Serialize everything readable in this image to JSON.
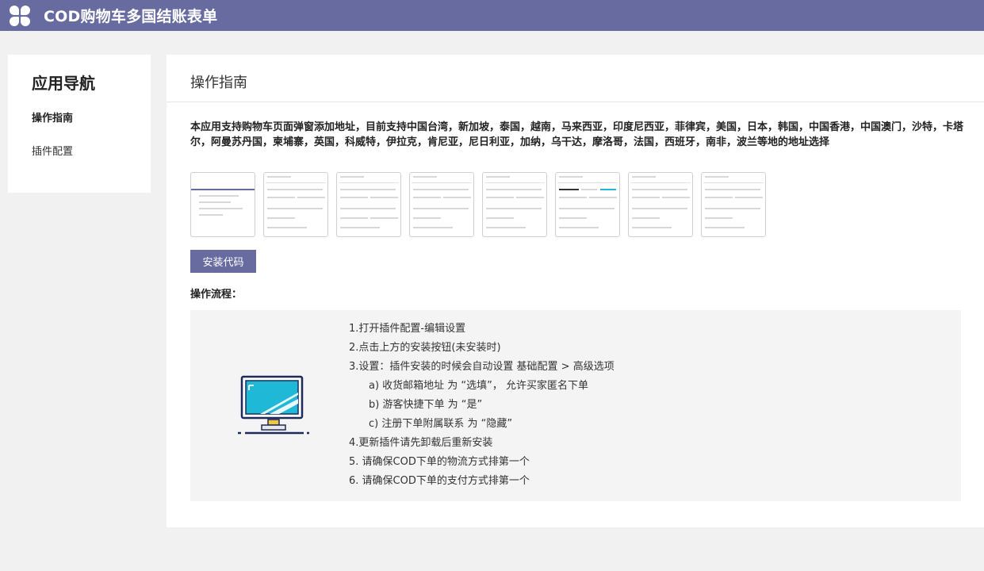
{
  "app": {
    "title": "COD购物车多国结账表单"
  },
  "sidebar": {
    "title": "应用导航",
    "items": [
      {
        "label": "操作指南"
      },
      {
        "label": "插件配置"
      }
    ]
  },
  "main": {
    "title": "操作指南",
    "description": "本应用支持购物车页面弹窗添加地址，目前支持中国台湾，新加坡，泰国，越南，马来西亚，印度尼西亚，菲律宾，美国，日本，韩国，中国香港，中国澳门，沙特，卡塔尔，阿曼苏丹国，柬埔寨，英国，科威特，伊拉克，肯尼亚，尼日利亚，加纳，乌干达，摩洛哥，法国，西班牙，南非，波兰等地的地址选择",
    "install_button": "安装代码",
    "flow_label": "操作流程：",
    "steps": [
      "1.打开插件配置-编辑设置",
      "2.点击上方的安装按钮(未安装时)",
      "3.设置：插件安装的时候会自动设置 基础配置 > 高级选项",
      "a) 收货邮箱地址 为 “选填”， 允许买家匿名下单",
      "b) 游客快捷下单 为 “是”",
      "c) 注册下单附属联系 为 “隐藏”",
      "4.更新插件请先卸载后重新安装",
      "5. 请确保COD下单的物流方式排第一个",
      "6. 请确保COD下单的支付方式排第一个"
    ]
  },
  "colors": {
    "accent": "#676ba0",
    "monitor_screen": "#1fb8d6",
    "monitor_frame": "#1e2a5a",
    "monitor_stand": "#f4c542"
  }
}
